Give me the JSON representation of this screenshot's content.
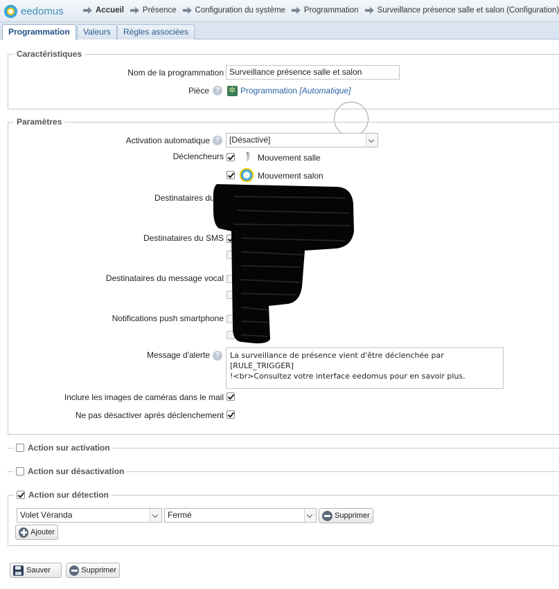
{
  "app": {
    "logo_text": "eedomus"
  },
  "breadcrumb": [
    "Accueil",
    "Présence",
    "Configuration du système",
    "Programmation",
    "Surveillance présence salle et salon (Configuration)"
  ],
  "tabs": [
    "Programmation",
    "Valeurs",
    "Règles associées"
  ],
  "caracteristiques": {
    "legend": "Caractéristiques",
    "name_label": "Nom de la programmation",
    "name_value": "Surveillance présence salle et salon",
    "room_label": "Pièce",
    "room_link": "Programmation",
    "room_auto": "[Automatique]"
  },
  "parametres": {
    "legend": "Paramètres",
    "activation_label": "Activation automatique",
    "activation_value": "[Désactivé]",
    "triggers_label": "Déclencheurs",
    "trigger1": "Mouvement salle",
    "trigger2": "Mouvement salon",
    "mail_label": "Destinataires du m",
    "sms_label": "Destinataires du SMS",
    "vocal_label": "Destinataires du message vocal",
    "push_label": "Notifications push smartphone",
    "alert_label": "Message d'alerte",
    "alert_line1": "La surveillance de présence vient d'être déclenchée par [RULE_TRIGGER]",
    "alert_line2": "!<br>Consultez votre interface eedomus pour en savoir plus.",
    "camera_label": "Inclure les images de caméras dans le mail",
    "nodisable_label": "Ne pas désactiver aprés déclenchement"
  },
  "sections": {
    "activation": "Action sur activation",
    "deactivation": "Action sur désactivation",
    "detection": "Action sur détection"
  },
  "detection": {
    "device_value": "Volet Véranda",
    "state_value": "Fermé",
    "delete_label": "Supprimer",
    "add_label": "Ajouter"
  },
  "footer": {
    "save_label": "Sauver",
    "delete_label": "Supprimer"
  }
}
